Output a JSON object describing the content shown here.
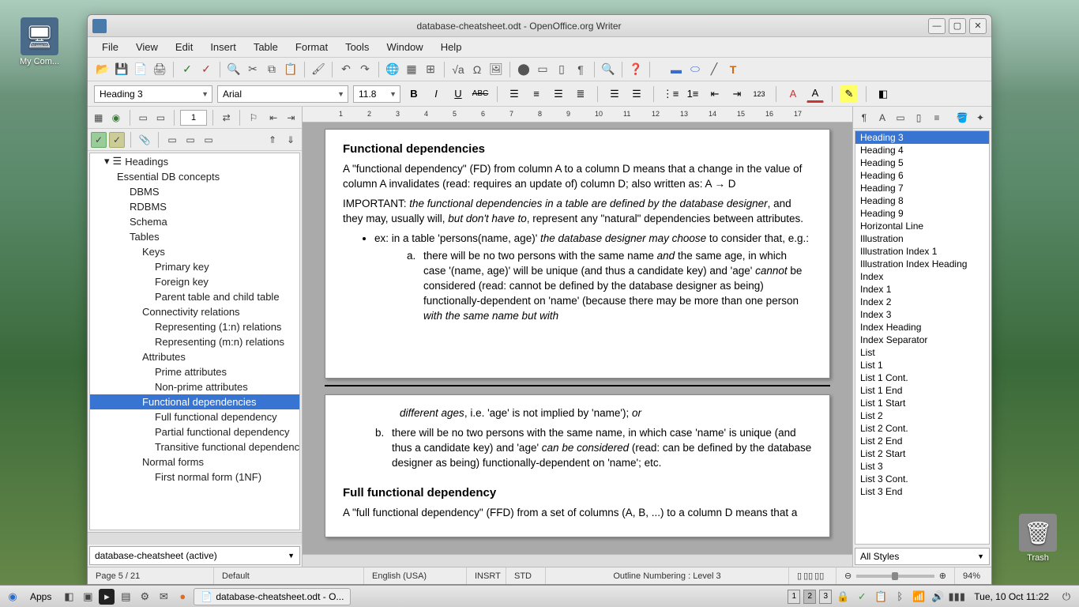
{
  "desktop": {
    "icons": [
      {
        "label": "My Com...",
        "glyph": "🖥"
      },
      {
        "label": "Trash",
        "glyph": "🗑"
      }
    ]
  },
  "window": {
    "title": "database-cheatsheet.odt - OpenOffice.org Writer",
    "menus": [
      "File",
      "View",
      "Edit",
      "Insert",
      "Table",
      "Format",
      "Tools",
      "Window",
      "Help"
    ]
  },
  "format": {
    "style": "Heading 3",
    "font": "Arial",
    "size": "11.8"
  },
  "navigator": {
    "root": "Headings",
    "spin_value": "1",
    "doc_combo": "database-cheatsheet (active)",
    "items": [
      {
        "label": "Essential DB concepts",
        "lvl": 1
      },
      {
        "label": "DBMS",
        "lvl": 2
      },
      {
        "label": "RDBMS",
        "lvl": 2
      },
      {
        "label": "Schema",
        "lvl": 2
      },
      {
        "label": "Tables",
        "lvl": 2
      },
      {
        "label": "Keys",
        "lvl": 3
      },
      {
        "label": "Primary key",
        "lvl": 4
      },
      {
        "label": "Foreign key",
        "lvl": 4
      },
      {
        "label": "Parent table and child table",
        "lvl": 4
      },
      {
        "label": "Connectivity relations",
        "lvl": 3
      },
      {
        "label": "Representing (1:n) relations",
        "lvl": 4
      },
      {
        "label": "Representing (m:n) relations",
        "lvl": 4
      },
      {
        "label": "Attributes",
        "lvl": 3
      },
      {
        "label": "Prime attributes",
        "lvl": 4
      },
      {
        "label": "Non-prime attributes",
        "lvl": 4
      },
      {
        "label": "Functional dependencies",
        "lvl": 3,
        "sel": true
      },
      {
        "label": "Full functional dependency",
        "lvl": 4
      },
      {
        "label": "Partial functional dependency",
        "lvl": 4
      },
      {
        "label": "Transitive functional dependency",
        "lvl": 4
      },
      {
        "label": "Normal forms",
        "lvl": 3
      },
      {
        "label": "First normal form (1NF)",
        "lvl": 4
      }
    ]
  },
  "document": {
    "h3_1": "Functional dependencies",
    "p1a": "A \"functional dependency\" (FD) from column A to a column D means that a change in the value of column A invalidates (read: requires an update of) column D; also written as: A → D",
    "p2a": "IMPORTANT: ",
    "p2b": "the functional dependencies in a table are defined by the database designer",
    "p2c": ", and they may, usually will, ",
    "p2d": "but don't have to",
    "p2e": ", represent any \"natural\" dependencies between attributes.",
    "li1a": "ex: in a table 'persons(name, age)' ",
    "li1b": "the database designer may choose",
    "li1c": " to consider that, e.g.:",
    "ol1a": "there will be no two persons with the same name ",
    "ol1b": "and",
    "ol1c": " the same age, in which case '(name, age)' will be unique (and thus a candidate key) and 'age' ",
    "ol1d": "cannot",
    "ol1e": " be considered (read: cannot be defined by the database designer as being) functionally-dependent on 'name' (because there may be more than one person ",
    "ol1f": "with the same name but with",
    "cont_a": "different ages",
    "cont_b": ", i.e. 'age' is not implied by 'name'); ",
    "cont_c": "or",
    "ol2a": "there will be no two persons with the same name, in which case 'name' is unique (and thus a candidate key) and 'age' ",
    "ol2b": "can be considered",
    "ol2c": " (read: can be defined by the database designer as being) functionally-dependent on 'name'; etc.",
    "h3_2": "Full functional dependency",
    "p3": "A \"full functional dependency\" (FFD) from a set of columns (A, B, ...) to a column D means that a"
  },
  "styles": {
    "selected": "Heading 3",
    "list": [
      "Heading 3",
      "Heading 4",
      "Heading 5",
      "Heading 6",
      "Heading 7",
      "Heading 8",
      "Heading 9",
      "Horizontal Line",
      "Illustration",
      "Illustration Index 1",
      "Illustration Index Heading",
      "Index",
      "Index 1",
      "Index 2",
      "Index 3",
      "Index Heading",
      "Index Separator",
      "List",
      "List 1",
      "List 1 Cont.",
      "List 1 End",
      "List 1 Start",
      "List 2",
      "List 2 Cont.",
      "List 2 End",
      "List 2 Start",
      "List 3",
      "List 3 Cont.",
      "List 3 End"
    ],
    "filter": "All Styles"
  },
  "status": {
    "page": "Page 5 / 21",
    "style": "Default",
    "lang": "English (USA)",
    "insert": "INSRT",
    "sel": "STD",
    "context": "Outline Numbering : Level 3",
    "zoom": "94%"
  },
  "taskbar": {
    "apps_label": "Apps",
    "task": "database-cheatsheet.odt - O...",
    "clock": "Tue, 10 Oct 11:22",
    "workspaces": [
      "1",
      "2",
      "3"
    ]
  },
  "ruler_ticks": [
    "1",
    "2",
    "3",
    "4",
    "5",
    "6",
    "7",
    "8",
    "9",
    "10",
    "11",
    "12",
    "13",
    "14",
    "15",
    "16",
    "17"
  ]
}
